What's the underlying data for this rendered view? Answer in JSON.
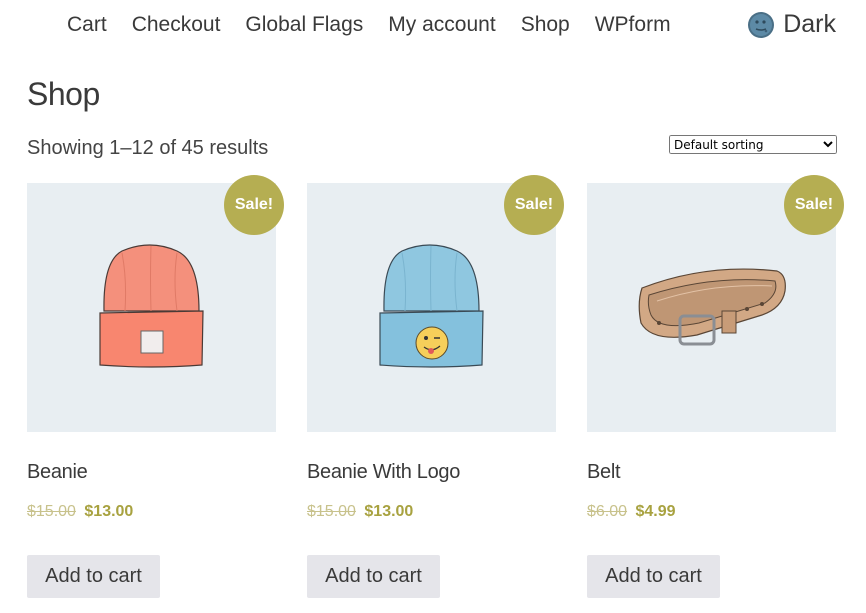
{
  "nav": {
    "items": [
      {
        "label": "Cart"
      },
      {
        "label": "Checkout"
      },
      {
        "label": "Global Flags"
      },
      {
        "label": "My account"
      },
      {
        "label": "Shop"
      },
      {
        "label": "WPform"
      }
    ],
    "dark_label": "Dark",
    "dark_icon": "moon-icon"
  },
  "page": {
    "title": "Shop",
    "result_count": "Showing 1–12 of 45 results",
    "sorting": {
      "selected": "Default sorting"
    }
  },
  "products": [
    {
      "title": "Beanie",
      "badge": "Sale!",
      "regular_price": "$15.00",
      "sale_price": "$13.00",
      "button": "Add to cart",
      "image": "orange beanie illustration"
    },
    {
      "title": "Beanie With Logo",
      "badge": "Sale!",
      "regular_price": "$15.00",
      "sale_price": "$13.00",
      "button": "Add to cart",
      "image": "blue beanie with winking emoji illustration"
    },
    {
      "title": "Belt",
      "badge": "Sale!",
      "regular_price": "$6.00",
      "sale_price": "$4.99",
      "button": "Add to cart",
      "image": "leather belt illustration"
    }
  ],
  "colors": {
    "sale_badge": "#b5ae52",
    "sale_price": "#a8a240",
    "thumb_bg": "#e8eef2",
    "button_bg": "#e5e5ea"
  }
}
